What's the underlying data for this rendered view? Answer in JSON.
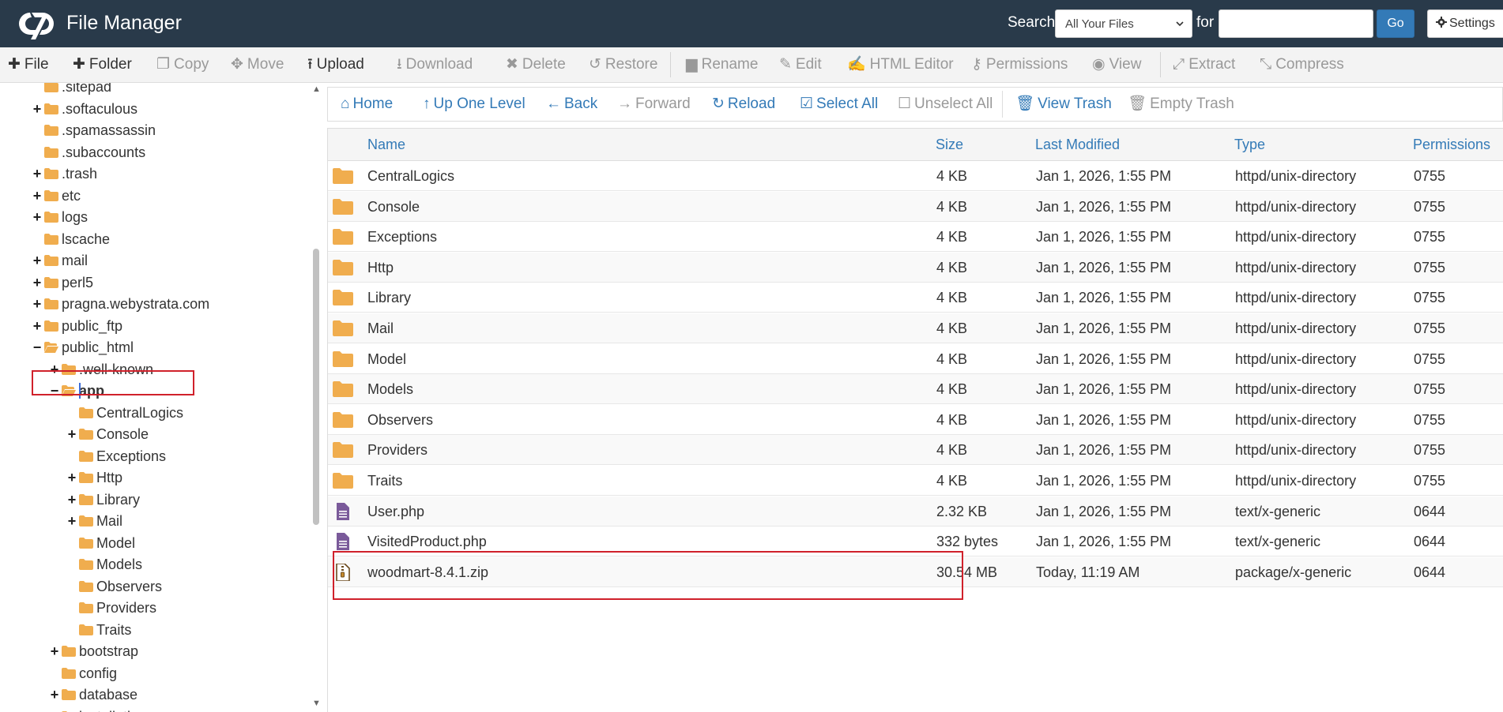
{
  "app": {
    "title": "File Manager"
  },
  "header": {
    "search_label": "Search",
    "search_scope": "All Your Files",
    "for_label": "for",
    "search_value": "",
    "go_label": "Go",
    "settings_label": "Settings"
  },
  "toolbar": [
    {
      "label": "File",
      "icon": "plus-icon",
      "active": true
    },
    {
      "label": "Folder",
      "icon": "plus-icon",
      "active": true
    },
    {
      "label": "Copy",
      "icon": "copy-icon",
      "active": false
    },
    {
      "label": "Move",
      "icon": "move-icon",
      "active": false
    },
    {
      "label": "Upload",
      "icon": "upload-icon",
      "active": true
    },
    {
      "label": "Download",
      "icon": "download-icon",
      "active": false
    },
    {
      "label": "Delete",
      "icon": "close-icon",
      "active": false
    },
    {
      "label": "Restore",
      "icon": "undo-icon",
      "active": false
    },
    {
      "label": "Rename",
      "icon": "file-icon",
      "active": false
    },
    {
      "label": "Edit",
      "icon": "pencil-icon",
      "active": false
    },
    {
      "label": "HTML Editor",
      "icon": "edit-box-icon",
      "active": false
    },
    {
      "label": "Permissions",
      "icon": "key-icon",
      "active": false
    },
    {
      "label": "View",
      "icon": "eye-icon",
      "active": false
    },
    {
      "label": "Extract",
      "icon": "expand-icon",
      "active": false
    },
    {
      "label": "Compress",
      "icon": "compress-icon",
      "active": false
    }
  ],
  "tree": [
    {
      "label": ".sitepad",
      "toggle": "",
      "level": 0
    },
    {
      "label": ".softaculous",
      "toggle": "+",
      "level": 0
    },
    {
      "label": ".spamassassin",
      "toggle": "",
      "level": 0
    },
    {
      "label": ".subaccounts",
      "toggle": "",
      "level": 0
    },
    {
      "label": ".trash",
      "toggle": "+",
      "level": 0
    },
    {
      "label": "etc",
      "toggle": "+",
      "level": 0
    },
    {
      "label": "logs",
      "toggle": "+",
      "level": 0
    },
    {
      "label": "lscache",
      "toggle": "",
      "level": 0
    },
    {
      "label": "mail",
      "toggle": "+",
      "level": 0
    },
    {
      "label": "perl5",
      "toggle": "+",
      "level": 0
    },
    {
      "label": "pragna.webystrata.com",
      "toggle": "+",
      "level": 0
    },
    {
      "label": "public_ftp",
      "toggle": "+",
      "level": 0
    },
    {
      "label": "public_html",
      "toggle": "−",
      "level": 0,
      "open": true
    },
    {
      "label": ".well-known",
      "toggle": "+",
      "level": 1
    },
    {
      "label": "app",
      "toggle": "−",
      "level": 1,
      "open": true,
      "selected": true
    },
    {
      "label": "CentralLogics",
      "toggle": "",
      "level": 2
    },
    {
      "label": "Console",
      "toggle": "+",
      "level": 2
    },
    {
      "label": "Exceptions",
      "toggle": "",
      "level": 2
    },
    {
      "label": "Http",
      "toggle": "+",
      "level": 2
    },
    {
      "label": "Library",
      "toggle": "+",
      "level": 2
    },
    {
      "label": "Mail",
      "toggle": "+",
      "level": 2
    },
    {
      "label": "Model",
      "toggle": "",
      "level": 2
    },
    {
      "label": "Models",
      "toggle": "",
      "level": 2
    },
    {
      "label": "Observers",
      "toggle": "",
      "level": 2
    },
    {
      "label": "Providers",
      "toggle": "",
      "level": 2
    },
    {
      "label": "Traits",
      "toggle": "",
      "level": 2
    },
    {
      "label": "bootstrap",
      "toggle": "+",
      "level": 1
    },
    {
      "label": "config",
      "toggle": "",
      "level": 1
    },
    {
      "label": "database",
      "toggle": "+",
      "level": 1
    },
    {
      "label": "installation",
      "toggle": "+",
      "level": 1
    }
  ],
  "nav": [
    {
      "label": "Home",
      "icon": "home-icon",
      "disabled": false
    },
    {
      "label": "Up One Level",
      "icon": "arrow-up-icon",
      "disabled": false
    },
    {
      "label": "Back",
      "icon": "arrow-left-icon",
      "disabled": false
    },
    {
      "label": "Forward",
      "icon": "arrow-right-icon",
      "disabled": true
    },
    {
      "label": "Reload",
      "icon": "refresh-icon",
      "disabled": false
    },
    {
      "label": "Select All",
      "icon": "checkbox-checked-icon",
      "disabled": false
    },
    {
      "label": "Unselect All",
      "icon": "checkbox-empty-icon",
      "disabled": true
    },
    {
      "label": "View Trash",
      "icon": "trash-icon",
      "disabled": false
    },
    {
      "label": "Empty Trash",
      "icon": "trash-icon",
      "disabled": true
    }
  ],
  "table": {
    "columns": [
      "Name",
      "Size",
      "Last Modified",
      "Type",
      "Permissions"
    ],
    "rows": [
      {
        "name": "CentralLogics",
        "size": "4 KB",
        "modified": "Jan 1, 2026, 1:55 PM",
        "type": "httpd/unix-directory",
        "perms": "0755",
        "icon": "folder-icon"
      },
      {
        "name": "Console",
        "size": "4 KB",
        "modified": "Jan 1, 2026, 1:55 PM",
        "type": "httpd/unix-directory",
        "perms": "0755",
        "icon": "folder-icon"
      },
      {
        "name": "Exceptions",
        "size": "4 KB",
        "modified": "Jan 1, 2026, 1:55 PM",
        "type": "httpd/unix-directory",
        "perms": "0755",
        "icon": "folder-icon"
      },
      {
        "name": "Http",
        "size": "4 KB",
        "modified": "Jan 1, 2026, 1:55 PM",
        "type": "httpd/unix-directory",
        "perms": "0755",
        "icon": "folder-icon"
      },
      {
        "name": "Library",
        "size": "4 KB",
        "modified": "Jan 1, 2026, 1:55 PM",
        "type": "httpd/unix-directory",
        "perms": "0755",
        "icon": "folder-icon"
      },
      {
        "name": "Mail",
        "size": "4 KB",
        "modified": "Jan 1, 2026, 1:55 PM",
        "type": "httpd/unix-directory",
        "perms": "0755",
        "icon": "folder-icon"
      },
      {
        "name": "Model",
        "size": "4 KB",
        "modified": "Jan 1, 2026, 1:55 PM",
        "type": "httpd/unix-directory",
        "perms": "0755",
        "icon": "folder-icon"
      },
      {
        "name": "Models",
        "size": "4 KB",
        "modified": "Jan 1, 2026, 1:55 PM",
        "type": "httpd/unix-directory",
        "perms": "0755",
        "icon": "folder-icon"
      },
      {
        "name": "Observers",
        "size": "4 KB",
        "modified": "Jan 1, 2026, 1:55 PM",
        "type": "httpd/unix-directory",
        "perms": "0755",
        "icon": "folder-icon"
      },
      {
        "name": "Providers",
        "size": "4 KB",
        "modified": "Jan 1, 2026, 1:55 PM",
        "type": "httpd/unix-directory",
        "perms": "0755",
        "icon": "folder-icon"
      },
      {
        "name": "Traits",
        "size": "4 KB",
        "modified": "Jan 1, 2026, 1:55 PM",
        "type": "httpd/unix-directory",
        "perms": "0755",
        "icon": "folder-icon"
      },
      {
        "name": "User.php",
        "size": "2.32 KB",
        "modified": "Jan 1, 2026, 1:55 PM",
        "type": "text/x-generic",
        "perms": "0644",
        "icon": "file-text-icon"
      },
      {
        "name": "VisitedProduct.php",
        "size": "332 bytes",
        "modified": "Jan 1, 2026, 1:55 PM",
        "type": "text/x-generic",
        "perms": "0644",
        "icon": "file-text-icon"
      },
      {
        "name": "woodmart-8.4.1.zip",
        "size": "30.54 MB",
        "modified": "Today, 11:19 AM",
        "type": "package/x-generic",
        "perms": "0644",
        "icon": "zip-file-icon"
      }
    ]
  },
  "colors": {
    "header_bg": "#293a4a",
    "link": "#337ab7",
    "folder": "#f0ad4e",
    "file": "#7a5a9a",
    "highlight": "#d0212b"
  }
}
